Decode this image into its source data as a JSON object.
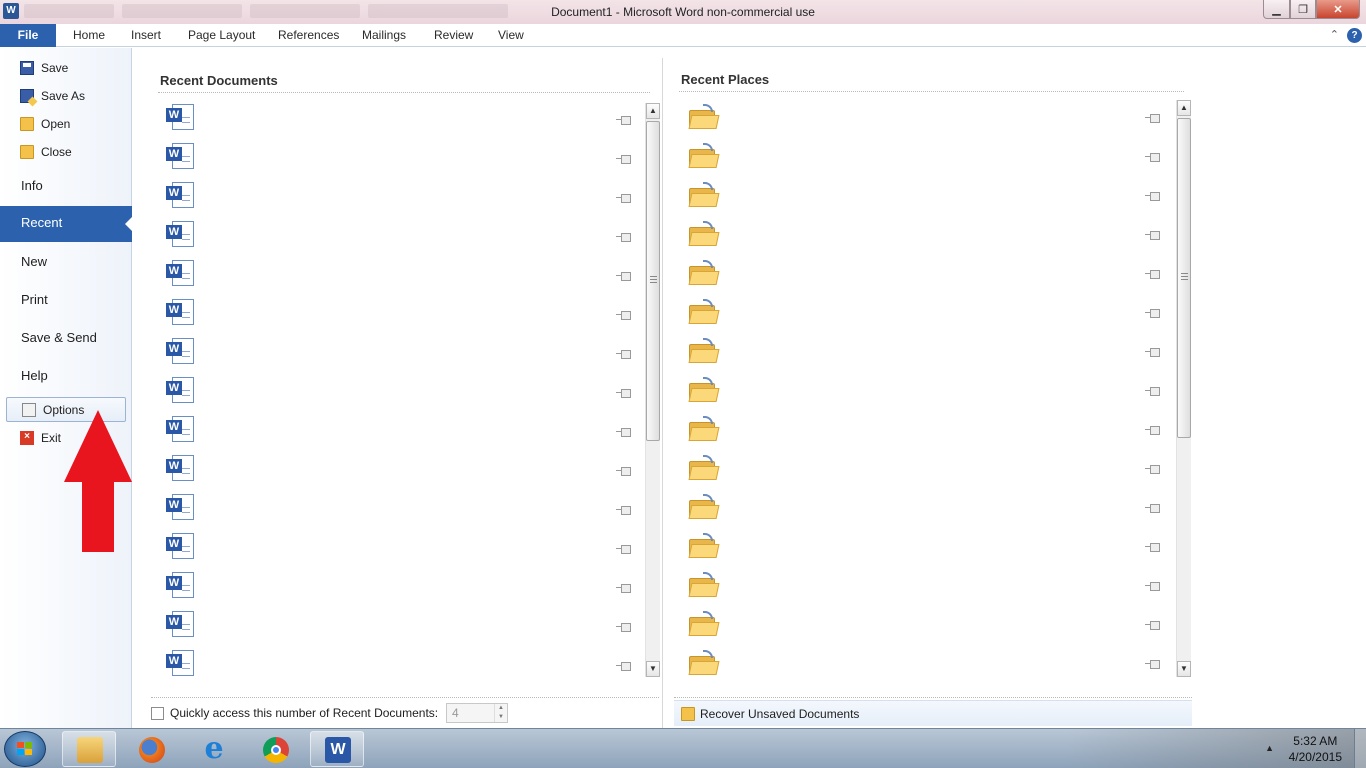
{
  "window": {
    "title": "Document1  -  Microsoft Word non-commercial use",
    "app_icon": "W"
  },
  "ribbon": {
    "file": "File",
    "tabs": [
      "Home",
      "Insert",
      "Page Layout",
      "References",
      "Mailings",
      "Review",
      "View"
    ]
  },
  "nav": {
    "small_top": [
      {
        "label": "Save",
        "icon": "save-icon"
      },
      {
        "label": "Save As",
        "icon": "save-as-icon"
      },
      {
        "label": "Open",
        "icon": "open-folder-icon"
      },
      {
        "label": "Close",
        "icon": "close-folder-icon"
      }
    ],
    "info": "Info",
    "recent": "Recent",
    "new": "New",
    "print": "Print",
    "save_send": "Save & Send",
    "help": "Help",
    "options": "Options",
    "exit": "Exit",
    "exit_glyph": "×"
  },
  "recent_documents": {
    "title": "Recent Documents",
    "count": 15,
    "icon_glyph": "W"
  },
  "recent_places": {
    "title": "Recent Places",
    "count": 15
  },
  "bottom": {
    "quick_access_label": "Quickly access this number of Recent Documents:",
    "quick_access_value": "4",
    "recover_label": "Recover Unsaved Documents"
  },
  "taskbar": {
    "time": "5:32 AM",
    "date": "4/20/2015",
    "word_glyph": "W",
    "ie_glyph": "e"
  },
  "colors": {
    "accent": "#2c62ad",
    "annotation_arrow": "#e8141e"
  }
}
